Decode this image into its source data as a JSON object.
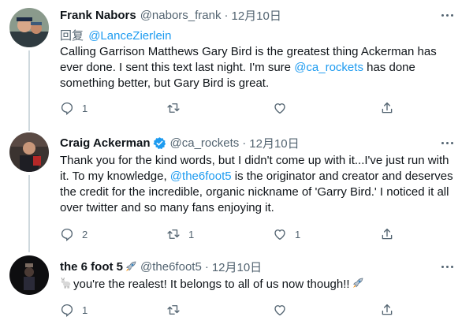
{
  "tweets": [
    {
      "display_name": "Frank Nabors",
      "handle": "@nabors_frank",
      "separator": "·",
      "date": "12月10日",
      "reply_prefix": "回复",
      "reply_handle": "@LanceZierlein",
      "text_parts": [
        "Calling Garrison Matthews Gary Bird is the greatest thing Ackerman has ever done. I sent this text last night. I'm sure ",
        "@ca_rockets",
        " has done something better, but Gary Bird is great."
      ],
      "reply_count": "1",
      "retweet_count": "",
      "like_count": ""
    },
    {
      "display_name": "Craig Ackerman",
      "handle": "@ca_rockets",
      "separator": "·",
      "date": "12月10日",
      "verified": true,
      "text_parts": [
        "Thank you for the kind words, but I didn't come up with it...I've just run with it. To my knowledge, ",
        "@the6foot5",
        " is the originator and creator and deserves the credit for the incredible, organic nickname of 'Garry Bird.' I noticed it all over twitter and so many fans enjoying it."
      ],
      "reply_count": "2",
      "retweet_count": "1",
      "like_count": "1"
    },
    {
      "display_name": "the 6 foot 5",
      "handle": "@the6foot5",
      "separator": "·",
      "date": "12月10日",
      "name_emoji": "rocket-emoji",
      "text_emoji_lead": "goat-emoji",
      "text": "you're the realest! It belongs to all of us now though!!",
      "text_emoji_trail": "rocket-emoji",
      "reply_count": "1",
      "retweet_count": "",
      "like_count": ""
    }
  ],
  "icons": {
    "reply": "reply-icon",
    "retweet": "retweet-icon",
    "like": "heart-icon",
    "share": "share-icon",
    "more": "more-icon",
    "verified": "verified-badge-icon"
  },
  "colors": {
    "link": "#1d9bf0",
    "secondary_text": "#536471",
    "primary_text": "#0f1419",
    "divider": "#eff3f4",
    "thread_line": "#cfd9de"
  }
}
